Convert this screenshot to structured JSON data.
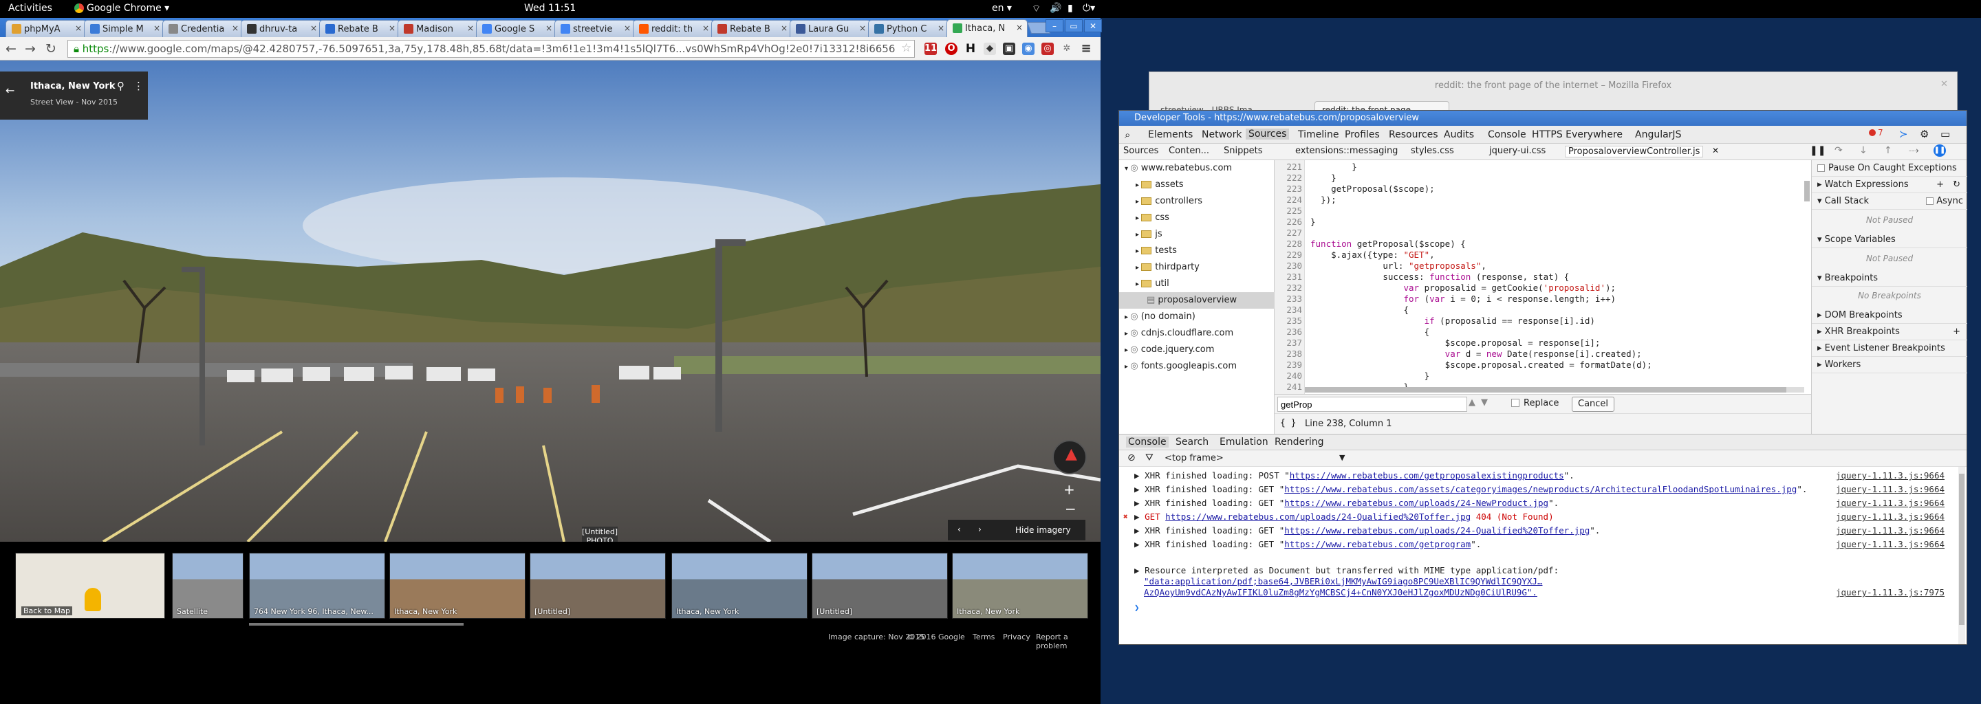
{
  "os_bar": {
    "activities": "Activities",
    "app": "Google Chrome ▾",
    "clock": "Wed 11:51",
    "lang": "en ▾"
  },
  "browser": {
    "tabs": [
      {
        "label": "phpMyA",
        "color": "#e0a030"
      },
      {
        "label": "Simple M",
        "color": "#3b7bd8"
      },
      {
        "label": "Credentia",
        "color": "#888888"
      },
      {
        "label": "dhruv-ta",
        "color": "#333333"
      },
      {
        "label": "Rebate B",
        "color": "#2a6ad0"
      },
      {
        "label": "Madison",
        "color": "#c0392b"
      },
      {
        "label": "Google S",
        "color": "#4285f4"
      },
      {
        "label": "streetvie",
        "color": "#4285f4"
      },
      {
        "label": "reddit: th",
        "color": "#ff5700"
      },
      {
        "label": "Rebate B",
        "color": "#c0392b"
      },
      {
        "label": "Laura Gu",
        "color": "#3b5998"
      },
      {
        "label": "Python C",
        "color": "#3572a5"
      },
      {
        "label": "Ithaca, N",
        "color": "#34a853"
      }
    ],
    "url_scheme": "https",
    "url_rest": "://www.google.com/maps/@42.4280757,-76.5097651,3a,75y,178.48h,85.68t/data=!3m6!1e1!3m4!1s5lQl7T6...vs0WhSmRp4VhOg!2e0!7i13312!8i6656"
  },
  "streetview": {
    "place": "Ithaca, New York",
    "date": "Street View - Nov 2015",
    "tooltip_title": "[Untitled]",
    "tooltip_sub": "PHOTO",
    "hide_imagery": "Hide imagery",
    "back_to_map": "Back to Map",
    "thumbs": [
      {
        "label": "Satellite",
        "color": "#8a8a8a"
      },
      {
        "label": "764 New York 96, Ithaca, New...",
        "color": "#7a8a9a"
      },
      {
        "label": "Ithaca, New York",
        "color": "#9a7a5a"
      },
      {
        "label": "[Untitled]",
        "color": "#7a6a5a"
      },
      {
        "label": "Ithaca, New York",
        "color": "#6a7a8a"
      },
      {
        "label": "[Untitled]",
        "color": "#6a6a6a"
      },
      {
        "label": "Ithaca, New York",
        "color": "#8a8a7a"
      }
    ],
    "footer": {
      "capture": "Image capture: Nov 2015",
      "copyright": "© 2016 Google",
      "terms": "Terms",
      "privacy": "Privacy",
      "report": "Report a problem"
    }
  },
  "firefox_window": {
    "title": "reddit: the front page of the internet – Mozilla Firefox",
    "tab1": "streetview - URBS Ima",
    "tab2": "reddit: the front page"
  },
  "devtools": {
    "title": "Developer Tools - https://www.rebatebus.com/proposaloverview",
    "tabs": [
      "Elements",
      "Network",
      "Sources",
      "Timeline",
      "Profiles",
      "Resources",
      "Audits",
      "Console",
      "HTTPS Everywhere",
      "AngularJS"
    ],
    "error_count": "7",
    "nav_tabs": [
      "Sources",
      "Conten...",
      "Snippets"
    ],
    "file_tabs": [
      "extensions::messaging",
      "styles.css",
      "jquery-ui.css",
      "ProposaloverviewController.js"
    ],
    "tree": [
      {
        "label": "www.rebatebus.com",
        "type": "domain"
      },
      {
        "label": "assets",
        "type": "folder"
      },
      {
        "label": "controllers",
        "type": "folder"
      },
      {
        "label": "css",
        "type": "folder"
      },
      {
        "label": "js",
        "type": "folder"
      },
      {
        "label": "tests",
        "type": "folder"
      },
      {
        "label": "thirdparty",
        "type": "folder"
      },
      {
        "label": "util",
        "type": "folder"
      },
      {
        "label": "proposaloverview",
        "type": "file"
      },
      {
        "label": "(no domain)",
        "type": "domain"
      },
      {
        "label": "cdnjs.cloudflare.com",
        "type": "domain"
      },
      {
        "label": "code.jquery.com",
        "type": "domain"
      },
      {
        "label": "fonts.googleapis.com",
        "type": "domain"
      }
    ],
    "code_lines": [
      {
        "n": "221",
        "t": "        }"
      },
      {
        "n": "222",
        "t": "    }"
      },
      {
        "n": "223",
        "t": "    getProposal($scope);"
      },
      {
        "n": "224",
        "t": "  });"
      },
      {
        "n": "225",
        "t": ""
      },
      {
        "n": "226",
        "t": "}"
      },
      {
        "n": "227",
        "t": ""
      },
      {
        "n": "228",
        "t": "function getProposal($scope) {"
      },
      {
        "n": "229",
        "t": "    $.ajax({type: \"GET\","
      },
      {
        "n": "230",
        "t": "              url: \"getproposals\","
      },
      {
        "n": "231",
        "t": "              success: function (response, stat) {"
      },
      {
        "n": "232",
        "t": "                  var proposalid = getCookie('proposalid');"
      },
      {
        "n": "233",
        "t": "                  for (var i = 0; i < response.length; i++)"
      },
      {
        "n": "234",
        "t": "                  {"
      },
      {
        "n": "235",
        "t": "                      if (proposalid == response[i].id)"
      },
      {
        "n": "236",
        "t": "                      {"
      },
      {
        "n": "237",
        "t": "                          $scope.proposal = response[i];"
      },
      {
        "n": "238",
        "t": "                          var d = new Date(response[i].created);"
      },
      {
        "n": "239",
        "t": "                          $scope.proposal.created = formatDate(d);"
      },
      {
        "n": "240",
        "t": "                      }"
      },
      {
        "n": "241",
        "t": "                  }"
      }
    ],
    "find_value": "getProp",
    "replace_label": "Replace",
    "cancel_label": "Cancel",
    "cursor_status": "Line 238, Column 1",
    "sidebar": {
      "pause_exceptions": "Pause On Caught Exceptions",
      "watch": "Watch Expressions",
      "call_stack": "Call Stack",
      "async": "Async",
      "not_paused": "Not Paused",
      "scope": "Scope Variables",
      "breakpoints": "Breakpoints",
      "no_breakpoints": "No Breakpoints",
      "dom_bp": "DOM Breakpoints",
      "xhr_bp": "XHR Breakpoints",
      "event_bp": "Event Listener Breakpoints",
      "workers": "Workers"
    },
    "drawer_tabs": [
      "Console",
      "Search",
      "Emulation",
      "Rendering"
    ],
    "context": "<top frame>",
    "console_rows": [
      {
        "kind": "xhr",
        "pre": "XHR finished loading: POST \"",
        "url": "https://www.rebatebus.com/getproposalexistingproducts",
        "post": "\".",
        "src": "jquery-1.11.3.js:9664"
      },
      {
        "kind": "xhr",
        "pre": "XHR finished loading: GET \"",
        "url": "https://www.rebatebus.com/assets/categoryimages/newproducts/ArchitecturalFloodandSpotLuminaires.jpg",
        "post": "\".",
        "src": "jquery-1.11.3.js:9664"
      },
      {
        "kind": "xhr",
        "pre": "XHR finished loading: GET \"",
        "url": "https://www.rebatebus.com/uploads/24-NewProduct.jpg",
        "post": "\".",
        "src": "jquery-1.11.3.js:9664"
      },
      {
        "kind": "err",
        "pre": "GET ",
        "url": "https://www.rebatebus.com/uploads/24-Qualified%20Toffer.jpg",
        "post": " 404 (Not Found)",
        "src": "jquery-1.11.3.js:9664"
      },
      {
        "kind": "xhr",
        "pre": "XHR finished loading: GET \"",
        "url": "https://www.rebatebus.com/uploads/24-Qualified%20Toffer.jpg",
        "post": "\".",
        "src": "jquery-1.11.3.js:9664"
      },
      {
        "kind": "xhr",
        "pre": "XHR finished loading: GET \"",
        "url": "https://www.rebatebus.com/getprogram",
        "post": "\".",
        "src": "jquery-1.11.3.js:9664"
      }
    ],
    "resource_line1": "Resource interpreted as Document but transferred with MIME type application/pdf:",
    "resource_line2": "\"data:application/pdf;base64,JVBERi0xLjMKMyAwIG9iago8PC9UeXBlIC9QYWdlIC9QYXJ…",
    "resource_line3": "AzQAoyUm9vdCAzNyAwIFIKL0luZm8gMzYgMCBSCj4+CnN0YXJ0eHJlZgoxMDUzNDg0CiUlRU9G\".",
    "resource_src": "jquery-1.11.3.js:7975",
    "prompt": "❯"
  }
}
